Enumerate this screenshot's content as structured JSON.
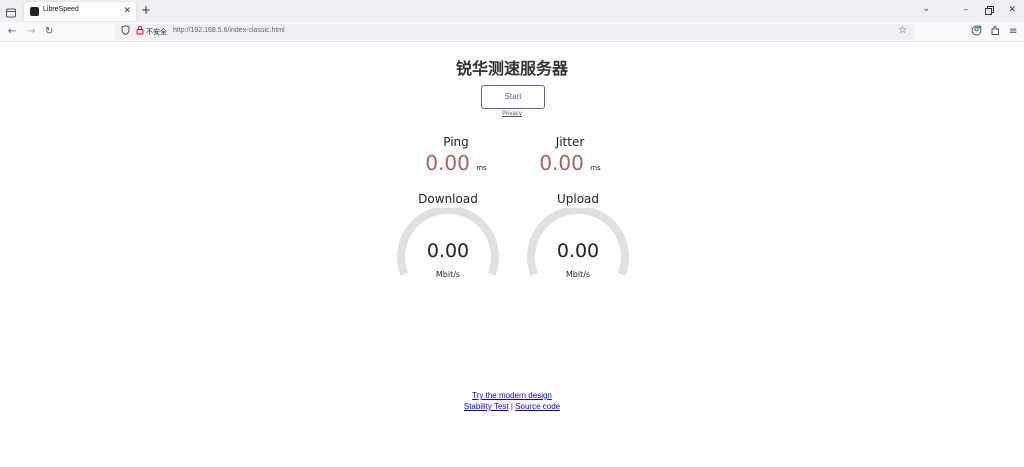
{
  "browser": {
    "tab_title": "LibreSpeed",
    "tab_close": "✕",
    "new_tab": "+",
    "url_insecure_label": "不安全",
    "url": "http://192.168.5.6/index-classic.html"
  },
  "page": {
    "title": "锐华测速服务器",
    "start_label": "Start",
    "privacy_label": "Privacy"
  },
  "meters": {
    "ping": {
      "label": "Ping",
      "value": "0.00",
      "unit": "ms"
    },
    "jitter": {
      "label": "Jitter",
      "value": "0.00",
      "unit": "ms"
    },
    "download": {
      "label": "Download",
      "value": "0.00",
      "unit": "Mbit/s",
      "fraction": 0
    },
    "upload": {
      "label": "Upload",
      "value": "0.00",
      "unit": "Mbit/s",
      "fraction": 0
    }
  },
  "footer": {
    "modern_design": "Try the modern design",
    "stability_test": "Stability Test",
    "separator": "|",
    "source_code": "Source code"
  },
  "colors": {
    "accent": "#6060aa",
    "value": "#aa6060",
    "gauge_track": "#e0e0e0"
  }
}
